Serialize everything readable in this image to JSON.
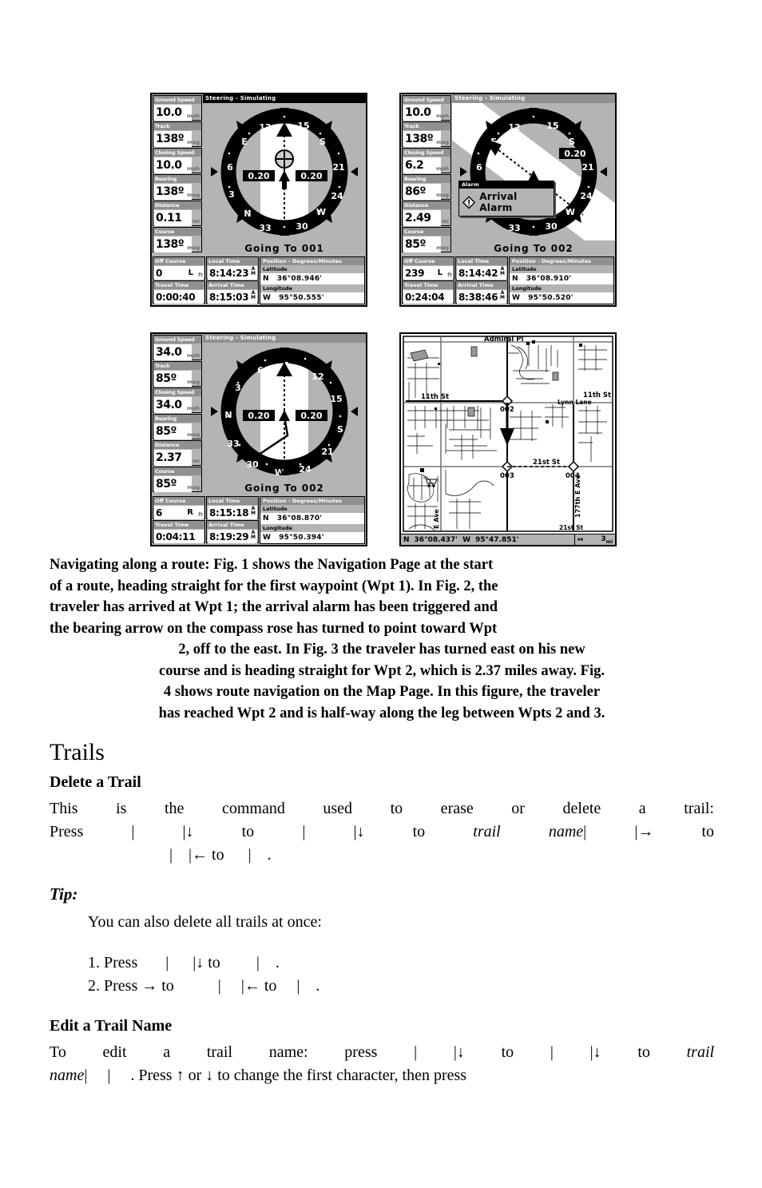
{
  "figures": [
    {
      "id": "fig1",
      "title": "Steering - Simulating",
      "goto": "Going To 001",
      "xte_left": "0.20",
      "xte_right": "0.20",
      "left_cells": [
        {
          "label": "Ground Speed",
          "value": "10.0",
          "unit": "mph"
        },
        {
          "label": "Track",
          "value": "138º",
          "unit": "mag"
        },
        {
          "label": "Closing Speed",
          "value": "10.0",
          "unit": "mph"
        },
        {
          "label": "Bearing",
          "value": "138º",
          "unit": "mag"
        },
        {
          "label": "Distance",
          "value": "0.11",
          "unit": "mi"
        },
        {
          "label": "Course",
          "value": "138º",
          "unit": "mag"
        }
      ],
      "off_course": {
        "label": "Off Course",
        "value": "0",
        "side": "L",
        "unit": "ft"
      },
      "travel_time": {
        "label": "Travel Time",
        "value": "0:00:40"
      },
      "local_time": {
        "label": "Local Time",
        "value": "8:14:23",
        "meridiem": "AM"
      },
      "arrival_time": {
        "label": "Arrival Time",
        "value": "8:15:03",
        "meridiem": "AM"
      },
      "position": {
        "header": "Position - Degrees/Minutes",
        "lat_label": "Latitude",
        "lat_hemi": "N",
        "lat_value": "36°08.946'",
        "lon_label": "Longitude",
        "lon_hemi": "W",
        "lon_value": "95°50.555'"
      },
      "alarm": null,
      "compass_labels": [
        "12",
        "15",
        "S",
        "21",
        "24",
        "W",
        "30",
        "33",
        "N",
        "3",
        "6",
        "E"
      ],
      "bearing_arrow": false
    },
    {
      "id": "fig2",
      "title": "Steering - Simulating",
      "goto": "Going To 002",
      "xte_left": "0.20",
      "xte_right": "0.20",
      "left_cells": [
        {
          "label": "Ground Speed",
          "value": "10.0",
          "unit": "mph"
        },
        {
          "label": "Track",
          "value": "138º",
          "unit": "mag"
        },
        {
          "label": "Closing Speed",
          "value": "6.2",
          "unit": "mph"
        },
        {
          "label": "Bearing",
          "value": "86º",
          "unit": "mag"
        },
        {
          "label": "Distance",
          "value": "2.49",
          "unit": "mi"
        },
        {
          "label": "Course",
          "value": "85º",
          "unit": "mag"
        }
      ],
      "off_course": {
        "label": "Off Course",
        "value": "239",
        "side": "L",
        "unit": "ft"
      },
      "travel_time": {
        "label": "Travel Time",
        "value": "0:24:04"
      },
      "local_time": {
        "label": "Local Time",
        "value": "8:14:42",
        "meridiem": "AM"
      },
      "arrival_time": {
        "label": "Arrival Time",
        "value": "8:38:46",
        "meridiem": "AM"
      },
      "position": {
        "header": "Position - Degrees/Minutes",
        "lat_label": "Latitude",
        "lat_hemi": "N",
        "lat_value": "36°08.910'",
        "lon_label": "Longitude",
        "lon_hemi": "W",
        "lon_value": "95°50.520'"
      },
      "alarm": {
        "title": "Alarm",
        "text": "Arrival Alarm",
        "icon": "warning-icon"
      },
      "compass_labels": [
        "12",
        "15",
        "S",
        "21",
        "24",
        "W",
        "30",
        "33",
        "N",
        "3",
        "6",
        "E"
      ],
      "bearing_arrow": true
    },
    {
      "id": "fig3",
      "title": "Steering - Simulating",
      "goto": "Going To 002",
      "xte_left": "0.20",
      "xte_right": "0.20",
      "left_cells": [
        {
          "label": "Ground Speed",
          "value": "34.0",
          "unit": "mph"
        },
        {
          "label": "Track",
          "value": "85º",
          "unit": "mag"
        },
        {
          "label": "Closing Speed",
          "value": "34.0",
          "unit": "mph"
        },
        {
          "label": "Bearing",
          "value": "85º",
          "unit": "mag"
        },
        {
          "label": "Distance",
          "value": "2.37",
          "unit": "mi"
        },
        {
          "label": "Course",
          "value": "85º",
          "unit": "mag"
        }
      ],
      "off_course": {
        "label": "Off Course",
        "value": "6",
        "side": "R",
        "unit": "ft"
      },
      "travel_time": {
        "label": "Travel Time",
        "value": "0:04:11"
      },
      "local_time": {
        "label": "Local Time",
        "value": "8:15:18",
        "meridiem": "AM"
      },
      "arrival_time": {
        "label": "Arrival Time",
        "value": "8:19:29",
        "meridiem": "AM"
      },
      "position": {
        "header": "Position - Degrees/Minutes",
        "lat_label": "Latitude",
        "lat_hemi": "N",
        "lat_value": "36°08.870'",
        "lon_label": "Longitude",
        "lon_hemi": "W",
        "lon_value": "95°50.394'"
      },
      "alarm": null,
      "compass_labels": [
        "E",
        "12",
        "15",
        "S",
        "21",
        "24",
        "W",
        "30",
        "33",
        "N",
        "3",
        "6"
      ],
      "bearing_arrow": false
    }
  ],
  "map": {
    "status": {
      "lat_hemi": "N",
      "lat_value": "36°08.437'",
      "lon_hemi": "W",
      "lon_value": "95°47.851'",
      "zoom_icon": "↔",
      "scale": "3",
      "scale_unit": "mi"
    },
    "street_labels": [
      "Admiral Pl",
      "11th St",
      "11th St",
      "Lynn Lane",
      "21st St",
      "21st St",
      "177th E Ave",
      "E Ave"
    ],
    "waypoints": [
      "002",
      "003",
      "004"
    ]
  },
  "caption": {
    "line1": "Navigating along a route: Fig. 1 shows the Navigation Page at the start",
    "line2": "of a route, heading straight for the first waypoint (Wpt 1). In Fig. 2, the",
    "line3": "traveler has arrived at Wpt 1; the arrival alarm has been triggered and",
    "line4": "the bearing arrow on the compass rose has turned to point toward Wpt",
    "line5": "2, off to the east. In Fig. 3 the traveler has turned east on his new",
    "line6": "course and is heading straight for Wpt 2, which is 2.37 miles away. Fig.",
    "line7": "4 shows route navigation on the Map Page. In this figure, the traveler",
    "line8": "has reached Wpt 2 and is half-way along the leg between Wpts 2 and 3."
  },
  "sections": {
    "trails_heading": "Trails",
    "delete_heading": "Delete a Trail",
    "delete_line1": "This is the command used to erase or delete a trail:",
    "delete_line2_a": "Press",
    "delete_line2_b": "|",
    "delete_line2_c": "|↓ to",
    "delete_line2_d": "|",
    "delete_line2_e": "|↓ to",
    "delete_line2_f": "trail name",
    "delete_line2_g": "|",
    "delete_line2_h": "|→ to",
    "delete_line3_a": "|",
    "delete_line3_b": "|← to",
    "delete_line3_c": "|",
    "delete_line3_d": ".",
    "tip_heading": "Tip:",
    "tip_intro": "You can also delete all trails at once:",
    "tip_item1_a": "1. Press",
    "tip_item1_b": "|",
    "tip_item1_c": "|↓ to",
    "tip_item1_d": "|",
    "tip_item1_e": ".",
    "tip_item2_a": "2. Press → to",
    "tip_item2_b": "|",
    "tip_item2_c": "|← to",
    "tip_item2_d": "|",
    "tip_item2_e": ".",
    "edit_heading": "Edit a Trail Name",
    "edit_line1_a": "To edit a trail name: press",
    "edit_line1_b": "|",
    "edit_line1_c": "|↓ to",
    "edit_line1_d": "|",
    "edit_line1_e": "|↓ to",
    "edit_line1_f": "trail",
    "edit_line2_a": "name",
    "edit_line2_b": "|",
    "edit_line2_c": "|",
    "edit_line2_d": ". Press ↑ or ↓ to change the first character, then press"
  },
  "colors": {
    "lcd_gray": "#b4b4b4",
    "label_gray": "#909090",
    "black": "#000000",
    "white": "#ffffff"
  }
}
